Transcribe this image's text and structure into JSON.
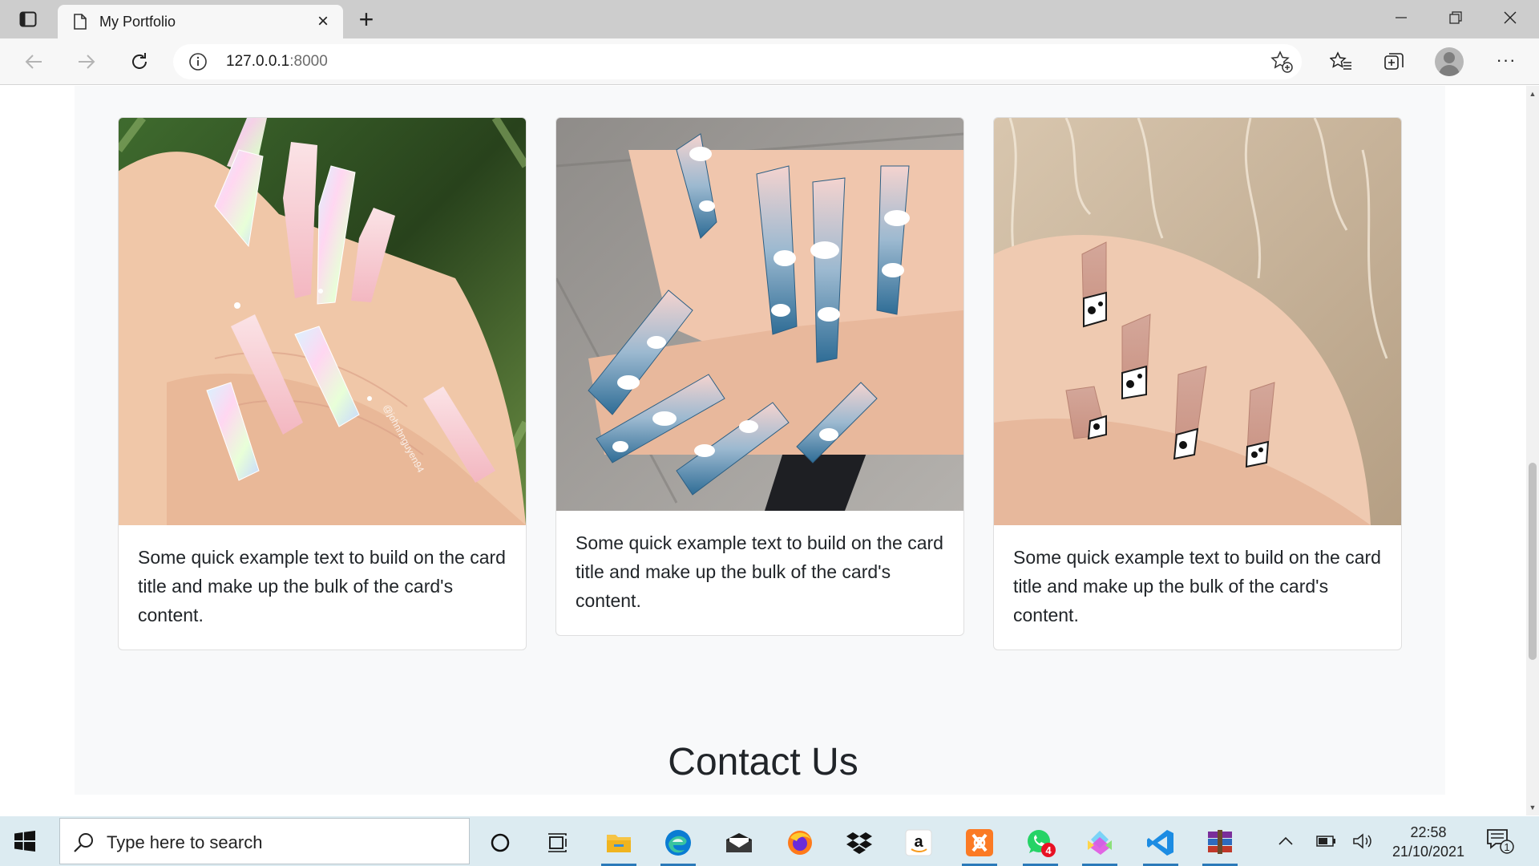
{
  "browser": {
    "tab_title": "My Portfolio",
    "url_host": "127.0.0.1",
    "url_port": ":8000",
    "new_tab_label": "+",
    "close_tab_label": "×"
  },
  "page": {
    "cards": [
      {
        "text": "Some quick example text to build on the card title and make up the bulk of the card's content.",
        "image": "nails-holographic-pink-coffin"
      },
      {
        "text": "Some quick example text to build on the card title and make up the bulk of the card's content.",
        "image": "nails-blue-cloud-ombre"
      },
      {
        "text": "Some quick example text to build on the card title and make up the bulk of the card's content.",
        "image": "nails-cow-print-french"
      }
    ],
    "photo_watermark": "@johnhnguyen94",
    "contact_heading": "Contact Us"
  },
  "taskbar": {
    "search_placeholder": "Type here to search",
    "time": "22:58",
    "date": "21/10/2021",
    "whatsapp_badge": "4",
    "notification_count": "1"
  },
  "colors": {
    "section_bg": "#f8f9fa",
    "taskbar_bg": "#dcebf1",
    "edge_blue": "#0a7cd3",
    "vscode_blue": "#1c8ce3"
  }
}
